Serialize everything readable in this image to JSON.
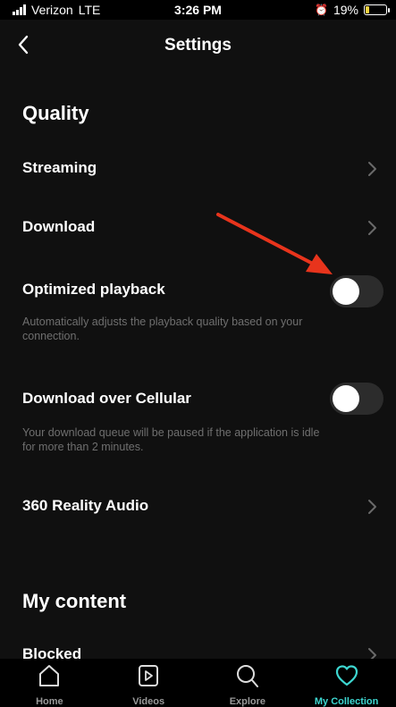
{
  "status_bar": {
    "carrier": "Verizon",
    "network": "LTE",
    "time": "3:26 PM",
    "battery": "19%",
    "battery_level": 0.19
  },
  "header": {
    "title": "Settings"
  },
  "sections": {
    "quality": "Quality",
    "my_content": "My content"
  },
  "rows": {
    "streaming": "Streaming",
    "download": "Download",
    "optimized_playback": {
      "label": "Optimized playback",
      "description": "Automatically adjusts the playback quality based on your connection.",
      "enabled": false
    },
    "download_over_cellular": {
      "label": "Download over Cellular",
      "description": "Your download queue will be paused if the application is idle for more than 2 minutes.",
      "enabled": false
    },
    "reality_audio": "360 Reality Audio",
    "blocked": "Blocked"
  },
  "tabs": [
    {
      "label": "Home",
      "icon": "home-icon",
      "active": false
    },
    {
      "label": "Videos",
      "icon": "video-icon",
      "active": false
    },
    {
      "label": "Explore",
      "icon": "search-icon",
      "active": false
    },
    {
      "label": "My Collection",
      "icon": "heart-icon",
      "active": true
    }
  ],
  "colors": {
    "accent": "#3dd6d0",
    "annotation_arrow": "#e8341c",
    "background": "#101010"
  }
}
